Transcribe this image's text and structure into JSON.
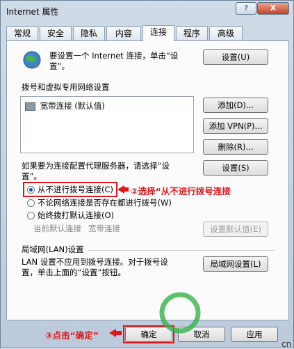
{
  "window": {
    "title": "Internet 属性",
    "help_label": "?",
    "close_label": "X"
  },
  "tabs": [
    {
      "label": "常规"
    },
    {
      "label": "安全"
    },
    {
      "label": "隐私"
    },
    {
      "label": "内容"
    },
    {
      "label": "连接",
      "active": true
    },
    {
      "label": "程序"
    },
    {
      "label": "高级"
    }
  ],
  "setup": {
    "line1": "要设置一个 Internet 连接，单击“设",
    "line2": "置”。",
    "button": "设置(U)"
  },
  "dialup": {
    "heading": "拨号和虚拟专用网络设置",
    "list_items": [
      "宽带连接 (默认值)"
    ],
    "add_button": "添加(D)...",
    "add_vpn_button": "添加 VPN(P)...",
    "delete_button": "删除(R)...",
    "proxy_line1": "如果要为连接配置代理服务器，请选择“设",
    "proxy_line2": "置”。",
    "settings_button": "设置(S)",
    "options": [
      {
        "label": "从不进行拨号连接(C)",
        "selected": true
      },
      {
        "label": "不论网络连接是否存在都进行拨号(W)",
        "selected": false
      },
      {
        "label": "始终拨打默认连接(O)",
        "selected": false
      }
    ],
    "current_default_label": "当前默认连接",
    "current_default_value": "宽带连接",
    "set_default_button": "设置默认值(E)"
  },
  "lan": {
    "heading": "局域网(LAN)设置",
    "desc_line1": "LAN 设置不应用到拨号连接。对于拨号设",
    "desc_line2": "置，单击上面的“设置”按钮。",
    "button": "局域网设置(L)"
  },
  "footer": {
    "ok_button": "确定",
    "cancel_button": "取消",
    "apply_button": "应用"
  },
  "annotations": {
    "step2": "②选择“从不进行拨号连接",
    "step3": "③点击“确定”",
    "color": "#e0161b"
  },
  "watermark": {
    "text": "cn"
  }
}
